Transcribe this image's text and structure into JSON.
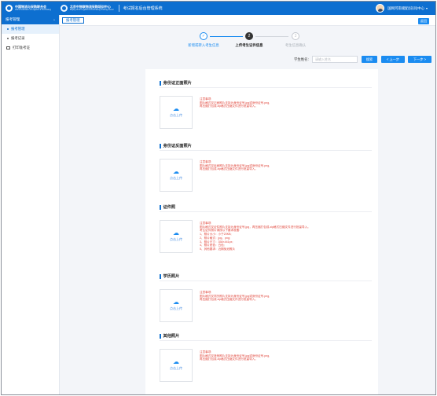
{
  "header": {
    "logo1_title": "中国物流与采购联合会",
    "logo1_sub": "China Federation of Logistics & Purchasing",
    "logo2_title": "北京中物联物流采购培训中心",
    "logo2_sub": "Beijing CFLP Logistics & Purchasing Training Center",
    "system_title": "考试报名后台管理系统",
    "user_name": "国网河南储配(培训)中心",
    "user_caret": "▾"
  },
  "sidebar": {
    "group_label": "报考管理",
    "group_chevron": "^",
    "items": [
      {
        "label": "报考管理",
        "active": true
      },
      {
        "label": "报考记录",
        "active": false
      },
      {
        "label": "打印准考证",
        "active": false
      }
    ]
  },
  "tabbar": {
    "tab_label": "报考管理",
    "back_label": "返回"
  },
  "steps": [
    {
      "label": "新增或转入考生信息",
      "symbol": "✓",
      "state": "done"
    },
    {
      "label": "上传考生证件信息",
      "symbol": "2",
      "state": "current"
    },
    {
      "label": "考生信息确认",
      "symbol": "3",
      "state": "todo"
    }
  ],
  "search": {
    "label": "学生姓名:",
    "placeholder": "请输入姓名",
    "search_button": "搜索",
    "prev_button": "< 上一步",
    "next_button": "下一步 >"
  },
  "upload_label": "点击上传",
  "sections": [
    {
      "title": "身份证正面照片",
      "notes": [
        "注意事项:",
        "图片格式仅正面照片支持为身份证号.jpg或身份证号.png,",
        "再压缩打包成.zip格式压缩文件进行批量导入。"
      ]
    },
    {
      "title": "身份证反面照片",
      "notes": [
        "注意事项:",
        "图片格式仅反面照片支持为身份证号.jpg或身份证号.png,",
        "再压缩打包成.zip格式压缩文件进行批量导入。"
      ]
    },
    {
      "title": "证件照",
      "notes": [
        "注意事项:",
        "图片格式仅证件照片支持为身份证号.jpg，再压缩打包成.zip格式压缩文件进行批量导入。",
        "考生证件照片请按以下要求准备:",
        "1、照片大小：小于20KB;",
        "2、照片格式：jpg、png;",
        "3、照片尺寸：358×441px;",
        "4、照片底色：白色;",
        "5、其他要求：近期免冠照片"
      ]
    },
    {
      "title": "学历照片",
      "notes": [
        "注意事项:",
        "图片格式仅学历照片支持为身份证号.jpg或身份证号.png,",
        "再压缩打包成.zip格式压缩文件进行批量导入。"
      ]
    },
    {
      "title": "其他照片",
      "notes": [
        "注意事项:",
        "图片格式仅其他照片支持为身份证号.jpg或身份证号.png,",
        "再压缩打包成.zip格式压缩文件进行批量导入。"
      ]
    }
  ],
  "colors": {
    "primary": "#0d6fd0",
    "button": "#1b8cf1",
    "note_text": "#e0453a",
    "background": "#f3f5f9"
  }
}
